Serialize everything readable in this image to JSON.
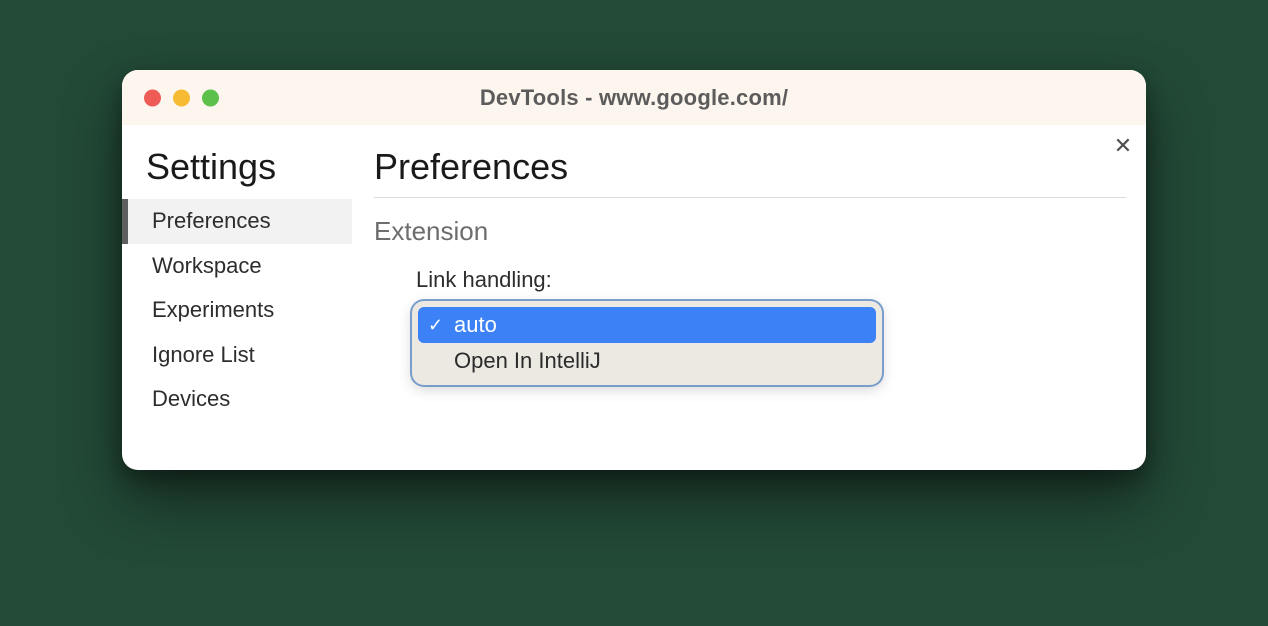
{
  "titlebar": {
    "title": "DevTools - www.google.com/"
  },
  "sidebar": {
    "title": "Settings",
    "items": [
      {
        "label": "Preferences",
        "active": true
      },
      {
        "label": "Workspace",
        "active": false
      },
      {
        "label": "Experiments",
        "active": false
      },
      {
        "label": "Ignore List",
        "active": false
      },
      {
        "label": "Devices",
        "active": false
      }
    ]
  },
  "main": {
    "close_symbol": "✕",
    "title": "Preferences",
    "section": {
      "title": "Extension",
      "link_handling": {
        "label": "Link handling:",
        "options": [
          {
            "label": "auto",
            "selected": true
          },
          {
            "label": "Open In IntelliJ",
            "selected": false
          }
        ]
      }
    }
  },
  "colors": {
    "option_selected": "#3c82f6",
    "titlebar_bg": "#fdf6ee"
  }
}
